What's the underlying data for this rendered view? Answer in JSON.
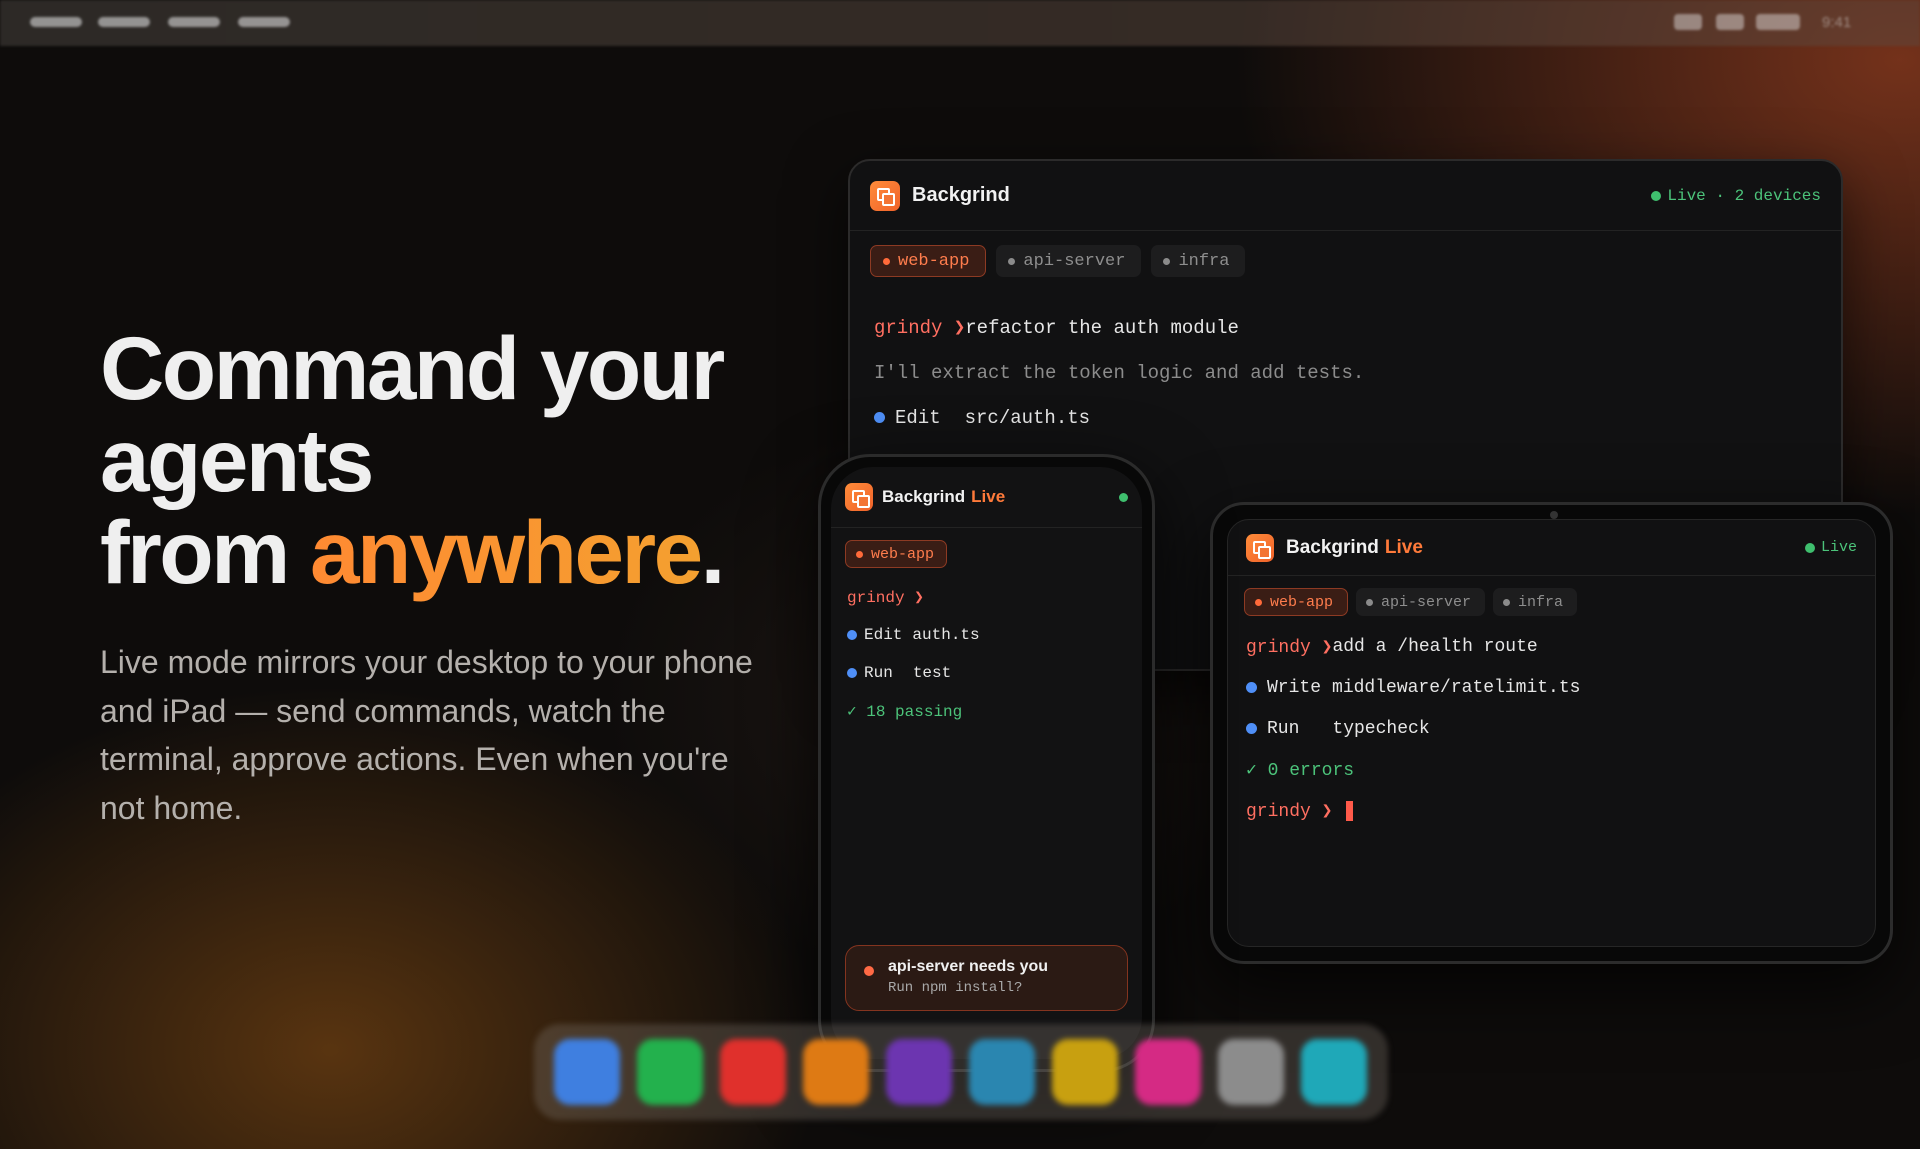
{
  "hero": {
    "title_line1": "Command your agents",
    "title_line2_prefix": "from ",
    "title_accent": "anywhere",
    "title_suffix": ".",
    "subtitle": "Live mode mirrors your desktop to your phone and iPad — send commands, watch the terminal, approve actions. Even when you're not home."
  },
  "app": {
    "name": "Backgrind",
    "live_label": "Live",
    "accent_color": "#ff7a3a",
    "status_color": "#3fbf6e"
  },
  "desktop": {
    "status": "Live · 2 devices",
    "tabs": [
      {
        "label": "web-app",
        "active": true
      },
      {
        "label": "api-server",
        "active": false
      },
      {
        "label": "infra",
        "active": false
      }
    ],
    "terminal": {
      "prompt": "grindy ❯",
      "command": "refactor the auth module",
      "response": "I'll extract the token logic and add tests.",
      "action_verb": "Edit",
      "action_target": "src/auth.ts"
    }
  },
  "ipad": {
    "status": "Live",
    "tabs": [
      {
        "label": "web-app",
        "active": true
      },
      {
        "label": "api-server",
        "active": false
      },
      {
        "label": "infra",
        "active": false
      }
    ],
    "terminal": {
      "prompt": "grindy ❯",
      "command": "add a /health route",
      "action1_verb": "Write",
      "action1_target": "middleware/ratelimit.ts",
      "action2_verb": "Run",
      "action2_target": "typecheck",
      "result": "✓ 0 errors",
      "final_prompt": "grindy ❯"
    }
  },
  "phone": {
    "tab": "web-app",
    "terminal": {
      "prompt": "grindy ❯",
      "action1_verb": "Edit",
      "action1_target": "auth.ts",
      "action2_verb": "Run",
      "action2_target": "test",
      "result": "✓ 18 passing"
    },
    "notification": {
      "title": "api-server needs you",
      "body": "Run npm install?"
    }
  },
  "menubar": {
    "clock": "9:41"
  }
}
